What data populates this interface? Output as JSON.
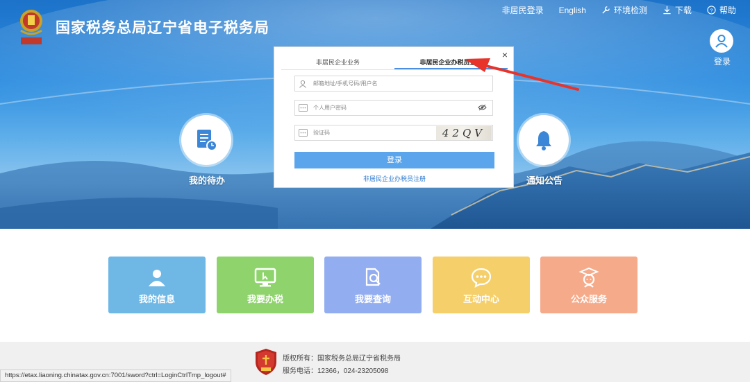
{
  "header": {
    "site_title": "国家税务总局辽宁省电子税务局",
    "nav": [
      {
        "label": "非居民登录",
        "icon": ""
      },
      {
        "label": "English",
        "icon": ""
      },
      {
        "label": "环境检测",
        "icon": "wrench-icon"
      },
      {
        "label": "下载",
        "icon": "download-icon"
      },
      {
        "label": "帮助",
        "icon": "help-icon"
      }
    ],
    "login_label": "登录"
  },
  "hero": {
    "left_button_label": "我的待办",
    "right_button_label": "通知公告"
  },
  "login_modal": {
    "close_symbol": "×",
    "tabs": [
      {
        "label": "非居民企业业务",
        "active": false
      },
      {
        "label": "非居民企业办税员登录",
        "active": true
      }
    ],
    "username_placeholder": "邮箱地址/手机号码/用户名",
    "password_placeholder": "个人用户密码",
    "captcha_placeholder": "验证码",
    "captcha_text": "42QV",
    "login_button": "登录",
    "register_link": "非居民企业办税员注册"
  },
  "tiles": [
    {
      "label": "我的信息",
      "icon": "user-icon",
      "color": "#6fb8e6"
    },
    {
      "label": "我要办税",
      "icon": "monitor-icon",
      "color": "#8fd36c"
    },
    {
      "label": "我要查询",
      "icon": "search-doc-icon",
      "color": "#93aef0"
    },
    {
      "label": "互动中心",
      "icon": "chat-icon",
      "color": "#f5cf6a"
    },
    {
      "label": "公众服务",
      "icon": "graduate-icon",
      "color": "#f5aa8a"
    }
  ],
  "footer": {
    "copyright": "版权所有：国家税务总局辽宁省税务局",
    "phone": "服务电话：12366，024-23205098",
    "status_url": "https://etax.liaoning.chinatax.gov.cn:7001/sword?ctrl=LoginCtrlTmp_logout#"
  },
  "colors": {
    "brand_blue": "#2f8ee0",
    "login_button": "#5aa5ec",
    "annotation_arrow": "#e8332a"
  }
}
